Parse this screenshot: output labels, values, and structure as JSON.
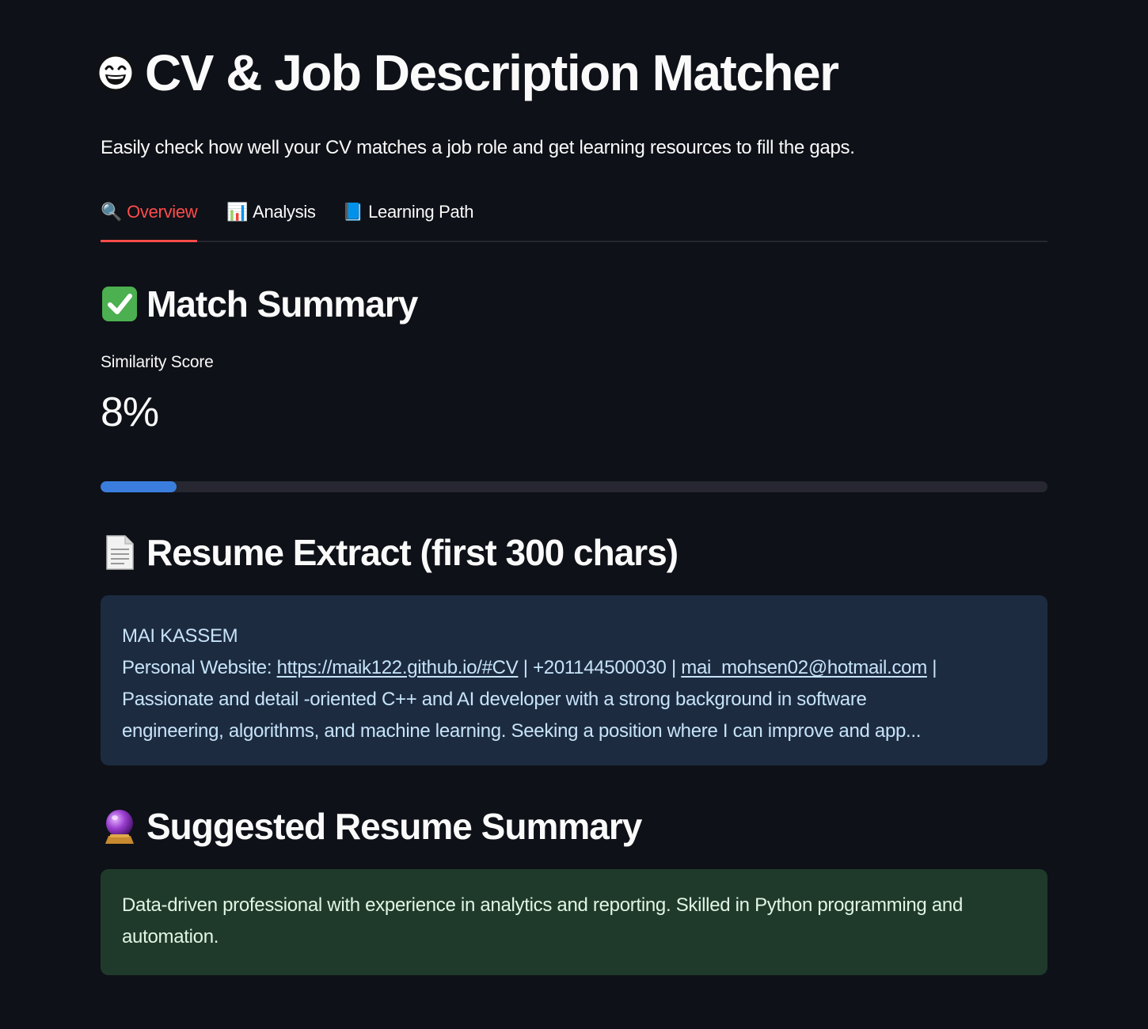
{
  "app": {
    "title": "CV & Job Description Matcher",
    "title_icon": "grinning-face-icon",
    "subtitle": "Easily check how well your CV matches a job role and get learning resources to fill the gaps."
  },
  "tabs": [
    {
      "icon": "🔍",
      "icon_name": "magnifier-icon",
      "label": "Overview",
      "active": true
    },
    {
      "icon": "📊",
      "icon_name": "bar-chart-icon",
      "label": "Analysis",
      "active": false
    },
    {
      "icon": "📘",
      "icon_name": "blue-book-icon",
      "label": "Learning Path",
      "active": false
    }
  ],
  "match_summary": {
    "heading": "Match Summary",
    "icon_name": "check-mark-icon",
    "metric_label": "Similarity Score",
    "metric_value": "8%",
    "progress_fraction": 0.08
  },
  "resume_extract": {
    "heading": "Resume Extract (first 300 chars)",
    "icon_name": "page-document-icon",
    "name": "MAI KASSEM",
    "website_prefix": "Personal Website: ",
    "website_link": "https://maik122.github.io/#CV",
    "sep1": " | +201144500030 | ",
    "email_link": "mai_mohsen02@hotmail.com",
    "sep2": " |",
    "line3": "Passionate and detail -oriented C++ and AI developer with a strong background in software",
    "line4": "engineering, algorithms, and machine learning. Seeking a position where I can improve and app..."
  },
  "suggested_summary": {
    "heading": "Suggested Resume Summary",
    "icon_name": "crystal-ball-icon",
    "text": "Data-driven professional with experience in analytics and reporting. Skilled in Python programming and automation."
  },
  "colors": {
    "background": "#0e1117",
    "accent": "#ff4b4b",
    "progress": "#3b7ddd",
    "info_box": "#1c2b40",
    "success_box": "#1f3a2a"
  }
}
